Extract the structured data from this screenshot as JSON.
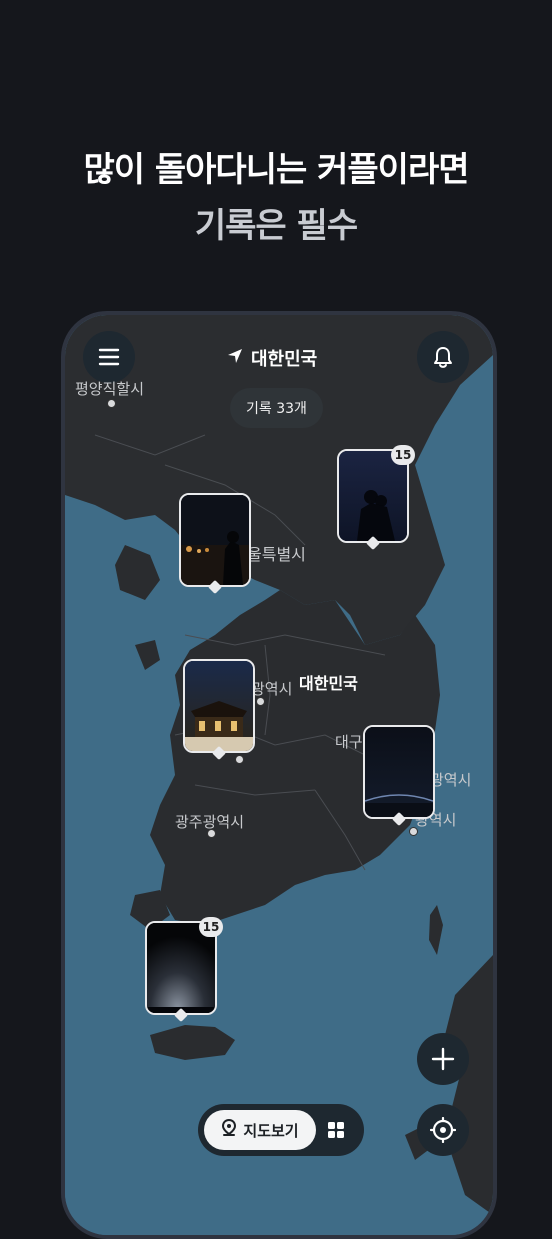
{
  "headline": {
    "line1": "많이 돌아다니는 커플이라면",
    "line2": "기록은 필수"
  },
  "header": {
    "menu_icon": "menu-icon",
    "location_icon": "navigation-arrow-icon",
    "location_title": "대한민국",
    "bell_icon": "bell-icon"
  },
  "record_count": "기록 33개",
  "map": {
    "labels": {
      "pyongyang": "평양직할시",
      "seoul": "울특별시",
      "country": "대한민국",
      "daejeon": "광역시",
      "daegu": "대구",
      "daegu_metro": "광역시",
      "ulsan": "광역시",
      "gwangju": "광주광역시"
    }
  },
  "markers": [
    {
      "id": "marker-gangwon",
      "badge": "15"
    },
    {
      "id": "marker-seoul",
      "badge": ""
    },
    {
      "id": "marker-chungcheong",
      "badge": ""
    },
    {
      "id": "marker-busan",
      "badge": ""
    },
    {
      "id": "marker-jeju",
      "badge": "15"
    }
  ],
  "bottom": {
    "map_view_label": "지도보기",
    "map_view_icon": "map-pin-icon",
    "grid_icon": "grid-icon",
    "add_icon": "plus-icon",
    "locate_icon": "crosshair-icon"
  },
  "colors": {
    "sea": "#3f6c87",
    "land": "#2a2c2f",
    "accent": "#ffffff"
  }
}
